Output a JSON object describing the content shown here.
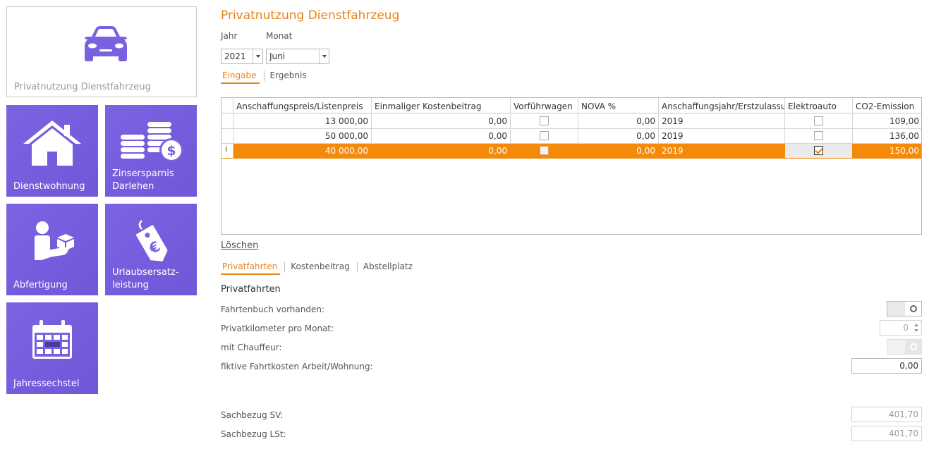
{
  "tiles": {
    "main": {
      "label": "Privatnutzung Dienstfahrzeug",
      "icon": "car-icon"
    },
    "items": [
      {
        "label": "Dienstwohnung",
        "icon": "house-icon"
      },
      {
        "label": "Zinsersparnis Darlehen",
        "icon": "coins-dollar-icon"
      },
      {
        "label": "Abfertigung",
        "icon": "person-package-icon"
      },
      {
        "label": "Urlaubsersatz-leistung",
        "icon": "euro-tag-icon"
      },
      {
        "label": "Jahressechstel",
        "icon": "calendar-icon"
      }
    ],
    "color": "#7a61e0"
  },
  "header": {
    "title": "Privatnutzung Dienstfahrzeug"
  },
  "filters": {
    "year_label": "Jahr",
    "year_value": "2021",
    "month_label": "Monat",
    "month_value": "Juni"
  },
  "main_tabs": [
    {
      "label": "Eingabe",
      "active": true
    },
    {
      "label": "Ergebnis",
      "active": false
    }
  ],
  "grid": {
    "columns": [
      "Anschaffungspreis/Listenpreis",
      "Einmaliger Kostenbeitrag",
      "Vorführwagen",
      "NOVA %",
      "Anschaffungsjahr/Erstzulassun...",
      "Elektroauto",
      "CO2-Emission"
    ],
    "rows": [
      {
        "price": "13 000,00",
        "cost": "0,00",
        "demo": false,
        "nova": "0,00",
        "year": "2019",
        "electric": false,
        "co2": "109,00"
      },
      {
        "price": "50 000,00",
        "cost": "0,00",
        "demo": false,
        "nova": "0,00",
        "year": "2019",
        "electric": false,
        "co2": "136,00"
      },
      {
        "price": "40 000,00",
        "cost": "0,00",
        "demo": false,
        "nova": "0,00",
        "year": "2019",
        "electric": true,
        "co2": "150,00",
        "selected": true,
        "indicator": "I"
      }
    ],
    "selection_color": "#f5890a"
  },
  "delete_link": "Löschen",
  "sub_tabs": [
    {
      "label": "Privatfahrten",
      "active": true
    },
    {
      "label": "Kostenbeitrag",
      "active": false
    },
    {
      "label": "Abstellplatz",
      "active": false
    }
  ],
  "privatfahrten": {
    "section_title": "Privatfahrten",
    "fahrtenbuch_label": "Fahrtenbuch vorhanden:",
    "privatkm_label": "Privatkilometer pro Monat:",
    "privatkm_value": "0",
    "chauffeur_label": "mit Chauffeur:",
    "fiktive_label": "fiktive Fahrtkosten Arbeit/Wohnung:",
    "fiktive_value": "0,00"
  },
  "sachbezug": {
    "sv_label": "Sachbezug SV:",
    "sv_value": "401,70",
    "lst_label": "Sachbezug LSt:",
    "lst_value": "401,70"
  },
  "accent_color": "#e8821a"
}
